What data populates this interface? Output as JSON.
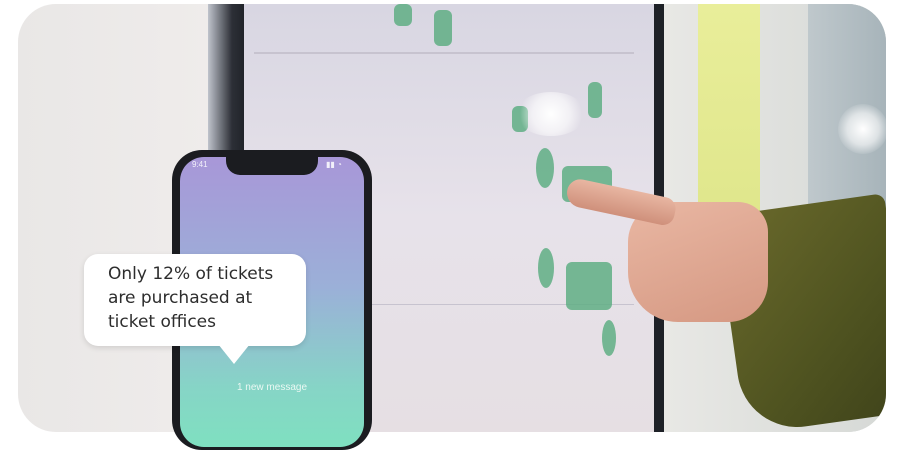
{
  "speech_bubble": {
    "text": "Only 12% of tickets\nare purchased at\nticket offices"
  },
  "phone": {
    "notification": "1 new message"
  },
  "colors": {
    "bubble": "#ffffff",
    "phone_gradient_top": "#a897d8",
    "phone_gradient_bottom": "#7fe0c0",
    "screen_button": "#5fae84",
    "sleeve": "#5a5d24"
  }
}
